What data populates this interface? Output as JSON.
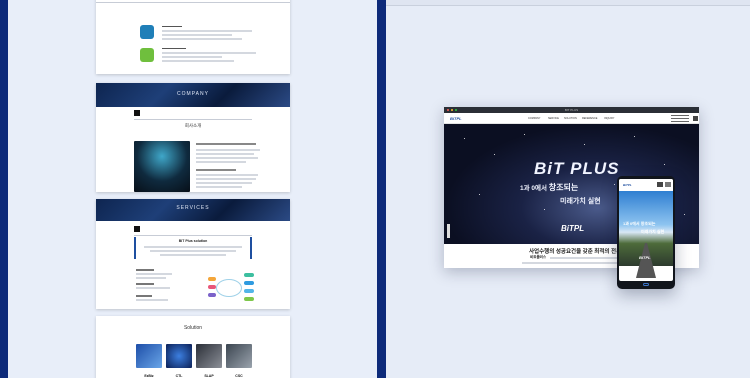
{
  "left_panel": {
    "company_banner": "COMPANY",
    "company_section_title": "회사소개",
    "services_banner": "SERVICES",
    "services_box_title": "BIT Plus solution",
    "solution_title": "Solution",
    "products": [
      "EzBiz",
      "CTL",
      "SLAP",
      "CSC"
    ]
  },
  "right_panel": {
    "browser_title": "BIT PLUS",
    "hero_title": "BiT PLUS",
    "hero_line1_a": "1과 0에서 ",
    "hero_line1_b": "창조되는",
    "hero_line2": "미래가치 실현",
    "hero_logo": "BiTPL",
    "section_heading": "사업수행의 성공요건을 갖춘 최적의 전문기업",
    "section_sub_bold": "비트플러스",
    "nav_items": [
      "COMPANY",
      "SERVICE",
      "SOLUTION",
      "REFERENCE",
      "INQUIRY"
    ],
    "phone_hero_line": "1과 0에서 창조되는",
    "phone_hero_line2": "미래가치 실현",
    "phone_logo": "BiTPL"
  },
  "colors": {
    "frame_blue": "#0d2a7a",
    "panel_bg": "#e8eef9",
    "accent_blue": "#1e4fa0"
  }
}
